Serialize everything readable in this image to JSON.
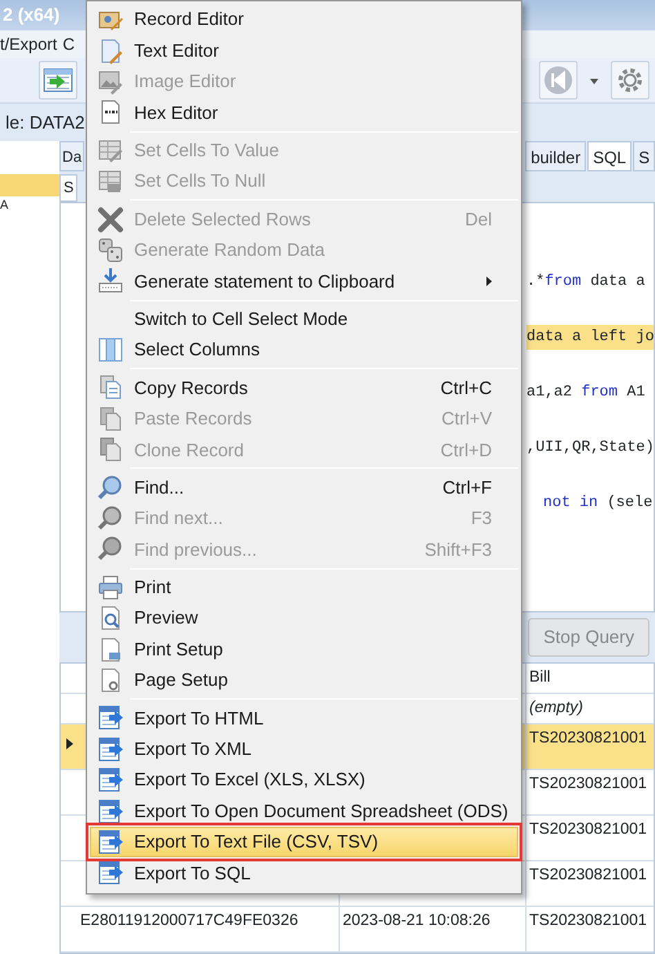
{
  "window": {
    "title": "2 (x64)"
  },
  "menu_bar": [
    "t/Export",
    "C"
  ],
  "table_label": "le: DATA2",
  "tree": {
    "items": [
      {
        "selected": true
      },
      {
        "label": "A",
        "selected": false
      }
    ]
  },
  "tabs": [
    {
      "label": "Da",
      "selected": false
    },
    {
      "label": "builder",
      "selected": false
    },
    {
      "label": "SQL",
      "selected": true
    },
    {
      "label": "S",
      "selected": false
    }
  ],
  "inner_tab": {
    "label": "S"
  },
  "sql_lines": [
    {
      "highlighted": false,
      "segments": [
        {
          "text": ".*",
          "keyword": false
        },
        {
          "text": "from",
          "keyword": true
        },
        {
          "text": " data a",
          "keyword": false
        }
      ]
    },
    {
      "highlighted": true,
      "segments": [
        {
          "text": "data a left jo",
          "keyword": false
        }
      ]
    },
    {
      "highlighted": false,
      "segments": [
        {
          "text": "a1,a2 ",
          "keyword": false
        },
        {
          "text": "from",
          "keyword": true
        },
        {
          "text": " A1",
          "keyword": false
        }
      ]
    },
    {
      "highlighted": false,
      "segments": [
        {
          "text": ",UII,QR,State)",
          "keyword": false
        }
      ]
    },
    {
      "highlighted": false,
      "segments": [
        {
          "text": "not in",
          "keyword": true
        },
        {
          "text": " (sele",
          "keyword": false
        }
      ]
    }
  ],
  "stop_button": {
    "label": "Stop Query",
    "disabled": true
  },
  "grid": {
    "columns": [
      "Bill"
    ],
    "filter_row": "(empty)",
    "rows": [
      {
        "selected": true,
        "bill": "TS20230821001"
      },
      {
        "selected": false,
        "bill": "TS20230821001"
      },
      {
        "selected": false,
        "bill": "TS20230821001"
      },
      {
        "selected": false,
        "bill": "TS20230821001"
      },
      {
        "selected": false,
        "column_1": "E28011912000717C49FE0326",
        "column_2": "2023-08-21 10:08:26",
        "bill": "TS20230821001"
      }
    ]
  },
  "context_menu": {
    "items": [
      {
        "kind": "item",
        "label": "Record Editor",
        "disabled": false,
        "selected": false,
        "outlined": false
      },
      {
        "kind": "item",
        "label": "Text Editor",
        "disabled": false,
        "selected": false,
        "outlined": false
      },
      {
        "kind": "item",
        "label": "Image Editor",
        "disabled": true,
        "selected": false,
        "outlined": false
      },
      {
        "kind": "item",
        "label": "Hex Editor",
        "disabled": false,
        "selected": false,
        "outlined": false
      },
      {
        "kind": "separator"
      },
      {
        "kind": "item",
        "label": "Set Cells To Value",
        "disabled": true,
        "selected": false,
        "outlined": false
      },
      {
        "kind": "item",
        "label": "Set Cells To Null",
        "disabled": true,
        "selected": false,
        "outlined": false
      },
      {
        "kind": "separator"
      },
      {
        "kind": "item",
        "label": "Delete Selected Rows",
        "shortcut": "Del",
        "disabled": true,
        "selected": false,
        "outlined": false
      },
      {
        "kind": "item",
        "label": "Generate Random Data",
        "disabled": true,
        "selected": false,
        "outlined": false
      },
      {
        "kind": "submenu",
        "label": "Generate statement to Clipboard",
        "disabled": false,
        "selected": false,
        "outlined": false
      },
      {
        "kind": "separator"
      },
      {
        "kind": "item",
        "label": "Switch to Cell Select Mode",
        "disabled": false,
        "selected": false,
        "outlined": false
      },
      {
        "kind": "item",
        "label": "Select Columns",
        "disabled": false,
        "selected": false,
        "outlined": false
      },
      {
        "kind": "separator"
      },
      {
        "kind": "item",
        "label": "Copy Records",
        "shortcut": "Ctrl+C",
        "disabled": false,
        "selected": false,
        "outlined": false
      },
      {
        "kind": "item",
        "label": "Paste Records",
        "shortcut": "Ctrl+V",
        "disabled": true,
        "selected": false,
        "outlined": false
      },
      {
        "kind": "item",
        "label": "Clone Record",
        "shortcut": "Ctrl+D",
        "disabled": true,
        "selected": false,
        "outlined": false
      },
      {
        "kind": "separator"
      },
      {
        "kind": "item",
        "label": "Find...",
        "shortcut": "Ctrl+F",
        "disabled": false,
        "selected": false,
        "outlined": false
      },
      {
        "kind": "item",
        "label": "Find next...",
        "shortcut": "F3",
        "disabled": true,
        "selected": false,
        "outlined": false
      },
      {
        "kind": "item",
        "label": "Find previous...",
        "shortcut": "Shift+F3",
        "disabled": true,
        "selected": false,
        "outlined": false
      },
      {
        "kind": "separator"
      },
      {
        "kind": "item",
        "label": "Print",
        "disabled": false,
        "selected": false,
        "outlined": false
      },
      {
        "kind": "item",
        "label": "Preview",
        "disabled": false,
        "selected": false,
        "outlined": false
      },
      {
        "kind": "item",
        "label": "Print Setup",
        "disabled": false,
        "selected": false,
        "outlined": false
      },
      {
        "kind": "item",
        "label": "Page Setup",
        "disabled": false,
        "selected": false,
        "outlined": false
      },
      {
        "kind": "separator"
      },
      {
        "kind": "item",
        "label": "Export To HTML",
        "disabled": false,
        "selected": false,
        "outlined": false
      },
      {
        "kind": "item",
        "label": "Export To XML",
        "disabled": false,
        "selected": false,
        "outlined": false
      },
      {
        "kind": "item",
        "label": "Export To Excel (XLS, XLSX)",
        "disabled": false,
        "selected": false,
        "outlined": false
      },
      {
        "kind": "item",
        "label": "Export To Open Document Spreadsheet (ODS)",
        "disabled": false,
        "selected": false,
        "outlined": false
      },
      {
        "kind": "item",
        "label": "Export To Text File (CSV, TSV)",
        "disabled": false,
        "selected": true,
        "outlined": true
      },
      {
        "kind": "item",
        "label": "Export To SQL",
        "disabled": false,
        "selected": false,
        "outlined": false
      }
    ]
  }
}
